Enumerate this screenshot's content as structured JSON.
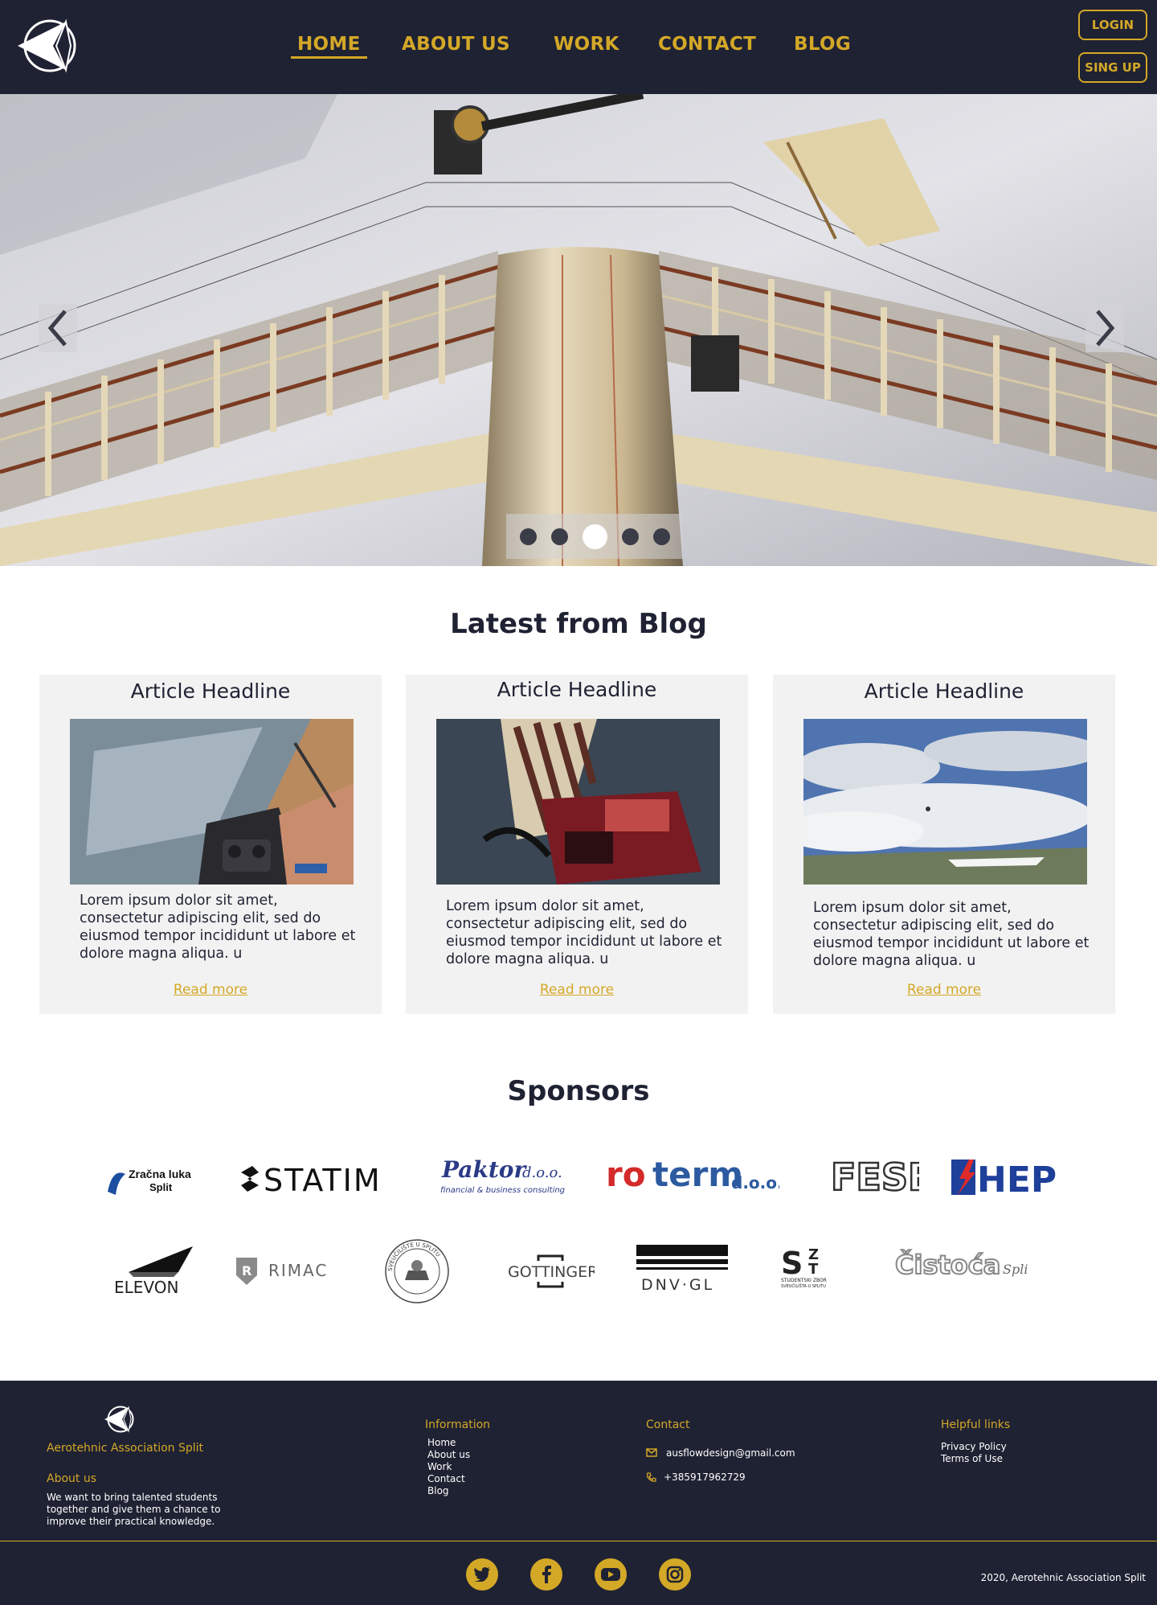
{
  "header": {
    "nav": [
      "HOME",
      "ABOUT US",
      "WORK",
      "CONTACT",
      "BLOG"
    ],
    "active_nav": "HOME",
    "login_label": "LOGIN",
    "signup_label": "SING UP",
    "accent_color": "#d4a827",
    "background_color": "#1f2233"
  },
  "hero": {
    "slide_count": 5,
    "active_slide": 3,
    "prev_icon": "chevron-left-icon",
    "next_icon": "chevron-right-icon"
  },
  "blog": {
    "title": "Latest from Blog",
    "articles": [
      {
        "headline": "Article Headline",
        "text": "Lorem ipsum dolor sit amet, consectetur adipiscing elit, sed do eiusmod tempor incididunt ut labore et dolore magna aliqua. u",
        "read_more": "Read more"
      },
      {
        "headline": "Article Headline",
        "text": "Lorem ipsum dolor sit amet, consectetur adipiscing elit, sed do eiusmod tempor incididunt ut labore et dolore magna aliqua. u",
        "read_more": "Read more"
      },
      {
        "headline": "Article Headline",
        "text": "Lorem ipsum dolor sit amet, consectetur adipiscing elit, sed do eiusmod tempor incididunt ut labore et dolore magna aliqua. u",
        "read_more": "Read more"
      }
    ]
  },
  "sponsors": {
    "title": "Sponsors",
    "row1": [
      "Zračna luka Split",
      "STATIM",
      "Paktor d.o.o.",
      "financial & business consulting",
      "roterm",
      "d.o.o.",
      "FESB",
      "HEP"
    ],
    "row2": [
      "ELEVON",
      "RIMAC",
      "SVEUČILIŠTE U SPLITU",
      "GOTTINGER",
      "DNV·GL",
      "STUDENTSKI ZBOR SVEUČILIŠTA U SPLITU",
      "Čistoća",
      "Split"
    ]
  },
  "footer": {
    "org_name": "Aerotehnic Association Split",
    "about_title": "About us",
    "about_text": "We want to bring talented students together and give them a chance to improve their practical knowledge.",
    "info_title": "Information",
    "info_links": [
      "Home",
      "About us",
      "Work",
      "Contact",
      "Blog"
    ],
    "contact_title": "Contact",
    "email": "ausflowdesign@gmail.com",
    "phone": "+385917962729",
    "helpful_title": "Helpful links",
    "helpful_links": [
      "Privacy Policy",
      "Terms of Use"
    ],
    "social": [
      "twitter-icon",
      "facebook-icon",
      "youtube-icon",
      "instagram-icon"
    ],
    "copyright": "2020, Aerotehnic Association Split"
  }
}
